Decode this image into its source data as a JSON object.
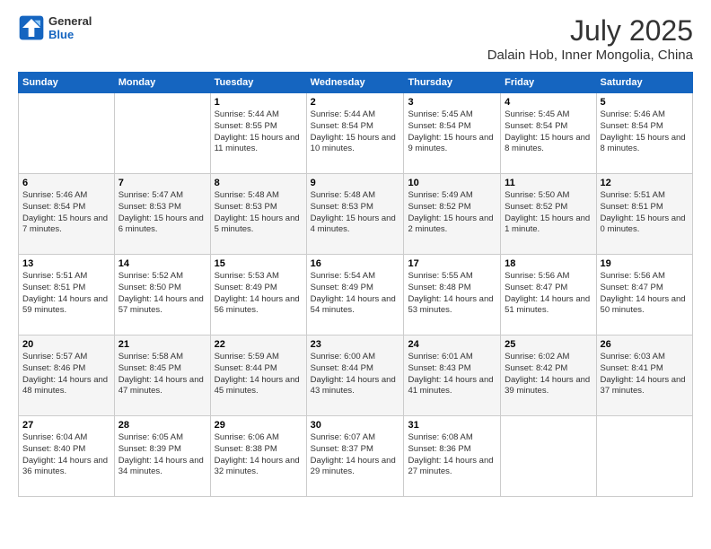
{
  "header": {
    "logo_general": "General",
    "logo_blue": "Blue",
    "title": "July 2025",
    "subtitle": "Dalain Hob, Inner Mongolia, China"
  },
  "calendar": {
    "days_of_week": [
      "Sunday",
      "Monday",
      "Tuesday",
      "Wednesday",
      "Thursday",
      "Friday",
      "Saturday"
    ],
    "weeks": [
      [
        {
          "day": "",
          "sunrise": "",
          "sunset": "",
          "daylight": ""
        },
        {
          "day": "",
          "sunrise": "",
          "sunset": "",
          "daylight": ""
        },
        {
          "day": "1",
          "sunrise": "Sunrise: 5:44 AM",
          "sunset": "Sunset: 8:55 PM",
          "daylight": "Daylight: 15 hours and 11 minutes."
        },
        {
          "day": "2",
          "sunrise": "Sunrise: 5:44 AM",
          "sunset": "Sunset: 8:54 PM",
          "daylight": "Daylight: 15 hours and 10 minutes."
        },
        {
          "day": "3",
          "sunrise": "Sunrise: 5:45 AM",
          "sunset": "Sunset: 8:54 PM",
          "daylight": "Daylight: 15 hours and 9 minutes."
        },
        {
          "day": "4",
          "sunrise": "Sunrise: 5:45 AM",
          "sunset": "Sunset: 8:54 PM",
          "daylight": "Daylight: 15 hours and 8 minutes."
        },
        {
          "day": "5",
          "sunrise": "Sunrise: 5:46 AM",
          "sunset": "Sunset: 8:54 PM",
          "daylight": "Daylight: 15 hours and 8 minutes."
        }
      ],
      [
        {
          "day": "6",
          "sunrise": "Sunrise: 5:46 AM",
          "sunset": "Sunset: 8:54 PM",
          "daylight": "Daylight: 15 hours and 7 minutes."
        },
        {
          "day": "7",
          "sunrise": "Sunrise: 5:47 AM",
          "sunset": "Sunset: 8:53 PM",
          "daylight": "Daylight: 15 hours and 6 minutes."
        },
        {
          "day": "8",
          "sunrise": "Sunrise: 5:48 AM",
          "sunset": "Sunset: 8:53 PM",
          "daylight": "Daylight: 15 hours and 5 minutes."
        },
        {
          "day": "9",
          "sunrise": "Sunrise: 5:48 AM",
          "sunset": "Sunset: 8:53 PM",
          "daylight": "Daylight: 15 hours and 4 minutes."
        },
        {
          "day": "10",
          "sunrise": "Sunrise: 5:49 AM",
          "sunset": "Sunset: 8:52 PM",
          "daylight": "Daylight: 15 hours and 2 minutes."
        },
        {
          "day": "11",
          "sunrise": "Sunrise: 5:50 AM",
          "sunset": "Sunset: 8:52 PM",
          "daylight": "Daylight: 15 hours and 1 minute."
        },
        {
          "day": "12",
          "sunrise": "Sunrise: 5:51 AM",
          "sunset": "Sunset: 8:51 PM",
          "daylight": "Daylight: 15 hours and 0 minutes."
        }
      ],
      [
        {
          "day": "13",
          "sunrise": "Sunrise: 5:51 AM",
          "sunset": "Sunset: 8:51 PM",
          "daylight": "Daylight: 14 hours and 59 minutes."
        },
        {
          "day": "14",
          "sunrise": "Sunrise: 5:52 AM",
          "sunset": "Sunset: 8:50 PM",
          "daylight": "Daylight: 14 hours and 57 minutes."
        },
        {
          "day": "15",
          "sunrise": "Sunrise: 5:53 AM",
          "sunset": "Sunset: 8:49 PM",
          "daylight": "Daylight: 14 hours and 56 minutes."
        },
        {
          "day": "16",
          "sunrise": "Sunrise: 5:54 AM",
          "sunset": "Sunset: 8:49 PM",
          "daylight": "Daylight: 14 hours and 54 minutes."
        },
        {
          "day": "17",
          "sunrise": "Sunrise: 5:55 AM",
          "sunset": "Sunset: 8:48 PM",
          "daylight": "Daylight: 14 hours and 53 minutes."
        },
        {
          "day": "18",
          "sunrise": "Sunrise: 5:56 AM",
          "sunset": "Sunset: 8:47 PM",
          "daylight": "Daylight: 14 hours and 51 minutes."
        },
        {
          "day": "19",
          "sunrise": "Sunrise: 5:56 AM",
          "sunset": "Sunset: 8:47 PM",
          "daylight": "Daylight: 14 hours and 50 minutes."
        }
      ],
      [
        {
          "day": "20",
          "sunrise": "Sunrise: 5:57 AM",
          "sunset": "Sunset: 8:46 PM",
          "daylight": "Daylight: 14 hours and 48 minutes."
        },
        {
          "day": "21",
          "sunrise": "Sunrise: 5:58 AM",
          "sunset": "Sunset: 8:45 PM",
          "daylight": "Daylight: 14 hours and 47 minutes."
        },
        {
          "day": "22",
          "sunrise": "Sunrise: 5:59 AM",
          "sunset": "Sunset: 8:44 PM",
          "daylight": "Daylight: 14 hours and 45 minutes."
        },
        {
          "day": "23",
          "sunrise": "Sunrise: 6:00 AM",
          "sunset": "Sunset: 8:44 PM",
          "daylight": "Daylight: 14 hours and 43 minutes."
        },
        {
          "day": "24",
          "sunrise": "Sunrise: 6:01 AM",
          "sunset": "Sunset: 8:43 PM",
          "daylight": "Daylight: 14 hours and 41 minutes."
        },
        {
          "day": "25",
          "sunrise": "Sunrise: 6:02 AM",
          "sunset": "Sunset: 8:42 PM",
          "daylight": "Daylight: 14 hours and 39 minutes."
        },
        {
          "day": "26",
          "sunrise": "Sunrise: 6:03 AM",
          "sunset": "Sunset: 8:41 PM",
          "daylight": "Daylight: 14 hours and 37 minutes."
        }
      ],
      [
        {
          "day": "27",
          "sunrise": "Sunrise: 6:04 AM",
          "sunset": "Sunset: 8:40 PM",
          "daylight": "Daylight: 14 hours and 36 minutes."
        },
        {
          "day": "28",
          "sunrise": "Sunrise: 6:05 AM",
          "sunset": "Sunset: 8:39 PM",
          "daylight": "Daylight: 14 hours and 34 minutes."
        },
        {
          "day": "29",
          "sunrise": "Sunrise: 6:06 AM",
          "sunset": "Sunset: 8:38 PM",
          "daylight": "Daylight: 14 hours and 32 minutes."
        },
        {
          "day": "30",
          "sunrise": "Sunrise: 6:07 AM",
          "sunset": "Sunset: 8:37 PM",
          "daylight": "Daylight: 14 hours and 29 minutes."
        },
        {
          "day": "31",
          "sunrise": "Sunrise: 6:08 AM",
          "sunset": "Sunset: 8:36 PM",
          "daylight": "Daylight: 14 hours and 27 minutes."
        },
        {
          "day": "",
          "sunrise": "",
          "sunset": "",
          "daylight": ""
        },
        {
          "day": "",
          "sunrise": "",
          "sunset": "",
          "daylight": ""
        }
      ]
    ]
  }
}
